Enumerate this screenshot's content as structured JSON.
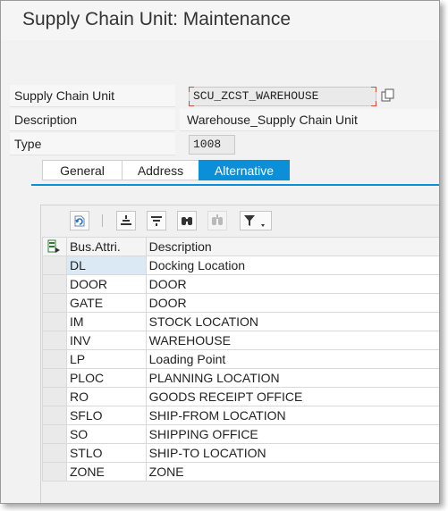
{
  "window": {
    "title": "Supply Chain Unit: Maintenance"
  },
  "form": {
    "scu_label": "Supply Chain Unit",
    "scu_value": "SCU_ZCST_WAREHOUSE",
    "description_label": "Description",
    "description_value": "Warehouse_Supply Chain Unit",
    "type_label": "Type",
    "type_value": "1008"
  },
  "tabs": [
    {
      "label": "General",
      "active": false
    },
    {
      "label": "Address",
      "active": false
    },
    {
      "label": "Alternative",
      "active": true
    }
  ],
  "grid": {
    "toolbar_icons": [
      "refresh-icon",
      "align-center-icon",
      "align-justify-icon",
      "find-icon",
      "find-next-icon",
      "filter-icon"
    ],
    "columns": [
      "Bus.Attri.",
      "Description"
    ],
    "rows": [
      {
        "code": "DL",
        "description": "Docking Location"
      },
      {
        "code": "DOOR",
        "description": "DOOR"
      },
      {
        "code": "GATE",
        "description": "DOOR"
      },
      {
        "code": "IM",
        "description": "STOCK LOCATION"
      },
      {
        "code": "INV",
        "description": "WAREHOUSE"
      },
      {
        "code": "LP",
        "description": "Loading Point"
      },
      {
        "code": "PLOC",
        "description": "PLANNING LOCATION"
      },
      {
        "code": "RO",
        "description": "GOODS RECEIPT OFFICE"
      },
      {
        "code": "SFLO",
        "description": "SHIP-FROM LOCATION"
      },
      {
        "code": "SO",
        "description": "SHIPPING OFFICE"
      },
      {
        "code": "STLO",
        "description": "SHIP-TO LOCATION"
      },
      {
        "code": "ZONE",
        "description": "ZONE"
      }
    ]
  },
  "colors": {
    "accent": "#0a8fd8",
    "required_marker": "#d24a3a"
  }
}
